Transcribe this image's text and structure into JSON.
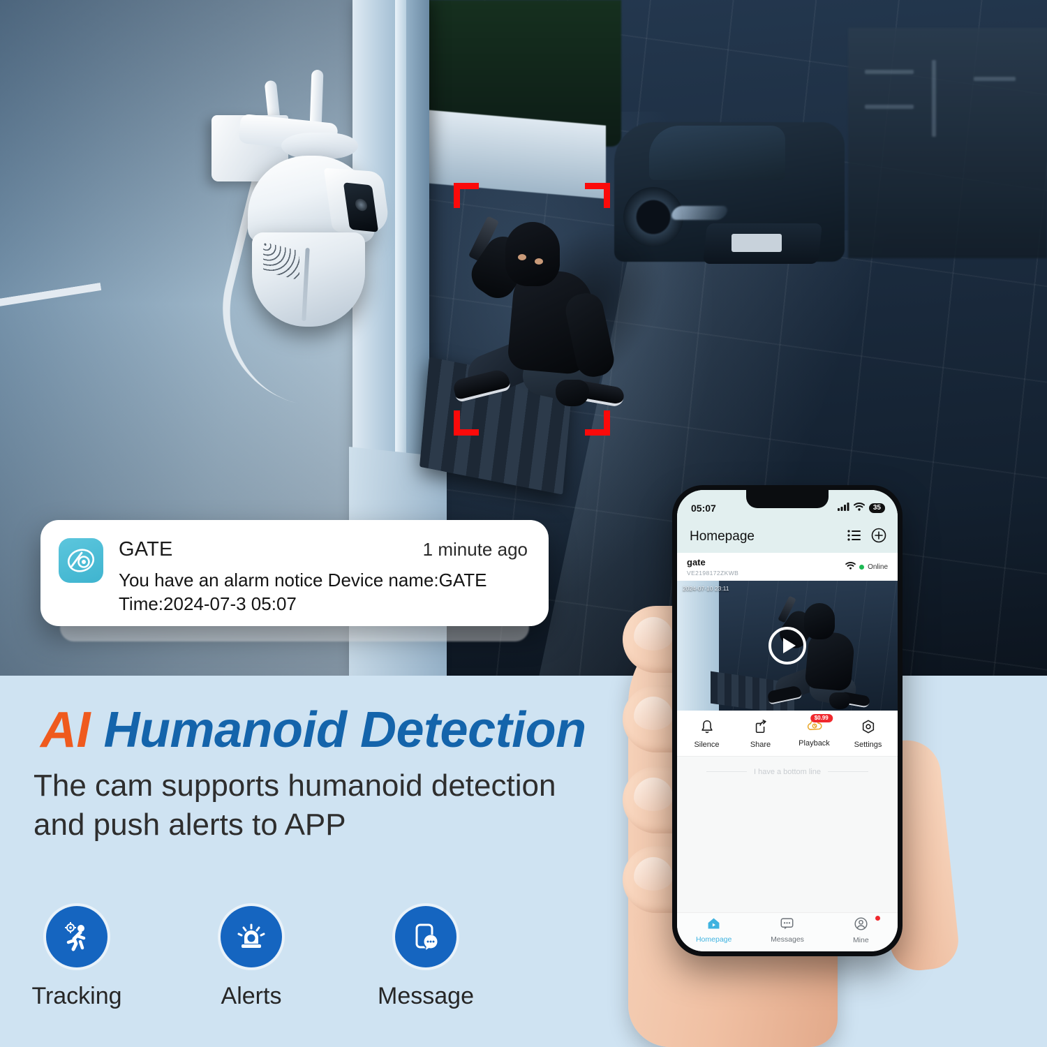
{
  "notification": {
    "app_name": "GATE",
    "time_ago": "1 minute ago",
    "message": "You have an alarm notice Device name:GATE Time:2024-07-3 05:07",
    "icon": "eye-lens-app-icon"
  },
  "promo": {
    "headline_accent": "AI",
    "headline_main": "Humanoid Detection",
    "subtitle": "The cam supports humanoid detection and push alerts to APP",
    "accent_color": "#ef5a1e",
    "main_color": "#1464ab",
    "background_color": "#cfe3f2"
  },
  "features": [
    {
      "label": "Tracking",
      "icon": "running-person-target-icon"
    },
    {
      "label": "Alerts",
      "icon": "siren-alarm-icon"
    },
    {
      "label": "Message",
      "icon": "phone-chat-bubble-icon"
    }
  ],
  "phone": {
    "status_bar": {
      "time": "05:07",
      "signal_icon": "cellular-signal-icon",
      "wifi_icon": "wifi-icon",
      "battery_level": "35"
    },
    "header": {
      "title": "Homepage",
      "list_icon": "list-icon",
      "add_icon": "plus-circle-icon"
    },
    "device": {
      "name": "gate",
      "id": "VE2198172ZKWB",
      "wifi_icon": "wifi-icon",
      "status": "Online",
      "status_color": "#1db954"
    },
    "preview": {
      "timestamp": "2024-07-10 23:11",
      "play_icon": "play-button-icon"
    },
    "actions": [
      {
        "label": "Silence",
        "icon": "bell-icon",
        "badge": ""
      },
      {
        "label": "Share",
        "icon": "share-icon",
        "badge": ""
      },
      {
        "label": "Playback",
        "icon": "cloud-playback-icon",
        "badge": "$0.99"
      },
      {
        "label": "Settings",
        "icon": "gear-hex-icon",
        "badge": ""
      }
    ],
    "bottom_line_text": "I have a bottom line",
    "tabs": [
      {
        "label": "Homepage",
        "icon": "home-play-icon",
        "active": true,
        "dot": false
      },
      {
        "label": "Messages",
        "icon": "chat-bubble-icon",
        "active": false,
        "dot": false
      },
      {
        "label": "Mine",
        "icon": "user-circle-icon",
        "active": false,
        "dot": true
      }
    ]
  },
  "scene": {
    "camera_device": "white-ptz-security-camera",
    "detection_brackets_color": "#fb0a0a",
    "subject": "masked-intruder-with-flashlight"
  }
}
